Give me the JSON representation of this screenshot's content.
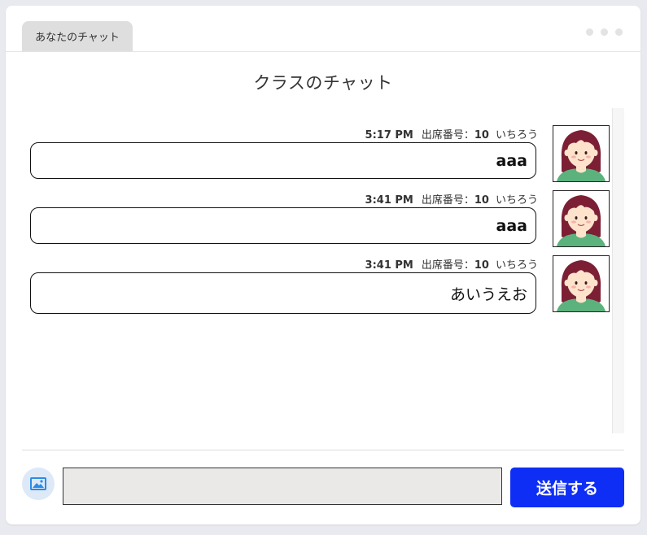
{
  "tab": {
    "label": "あなたのチャット"
  },
  "window": {
    "menu_icon": "more-horizontal-icon"
  },
  "title": "クラスのチャット",
  "messages": [
    {
      "time": "5:17 PM",
      "seat_label": "出席番号：",
      "seat_number": "10",
      "name": "いちろう",
      "text": "aaa",
      "avatar_icon": "student-avatar-girl"
    },
    {
      "time": "3:41 PM",
      "seat_label": "出席番号：",
      "seat_number": "10",
      "name": "いちろう",
      "text": "aaa",
      "avatar_icon": "student-avatar-girl"
    },
    {
      "time": "3:41 PM",
      "seat_label": "出席番号：",
      "seat_number": "10",
      "name": "いちろう",
      "text": "あいうえお",
      "avatar_icon": "student-avatar-girl"
    }
  ],
  "composer": {
    "image_icon": "image-icon",
    "input_value": "",
    "send_label": "送信する"
  },
  "colors": {
    "accent": "#0f2ef5",
    "image_button_bg": "#dde9f7",
    "image_icon": "#2a8ce6",
    "avatar_hair": "#7c1f35",
    "avatar_skin": "#fde3cc",
    "avatar_shirt": "#5cb27c"
  }
}
